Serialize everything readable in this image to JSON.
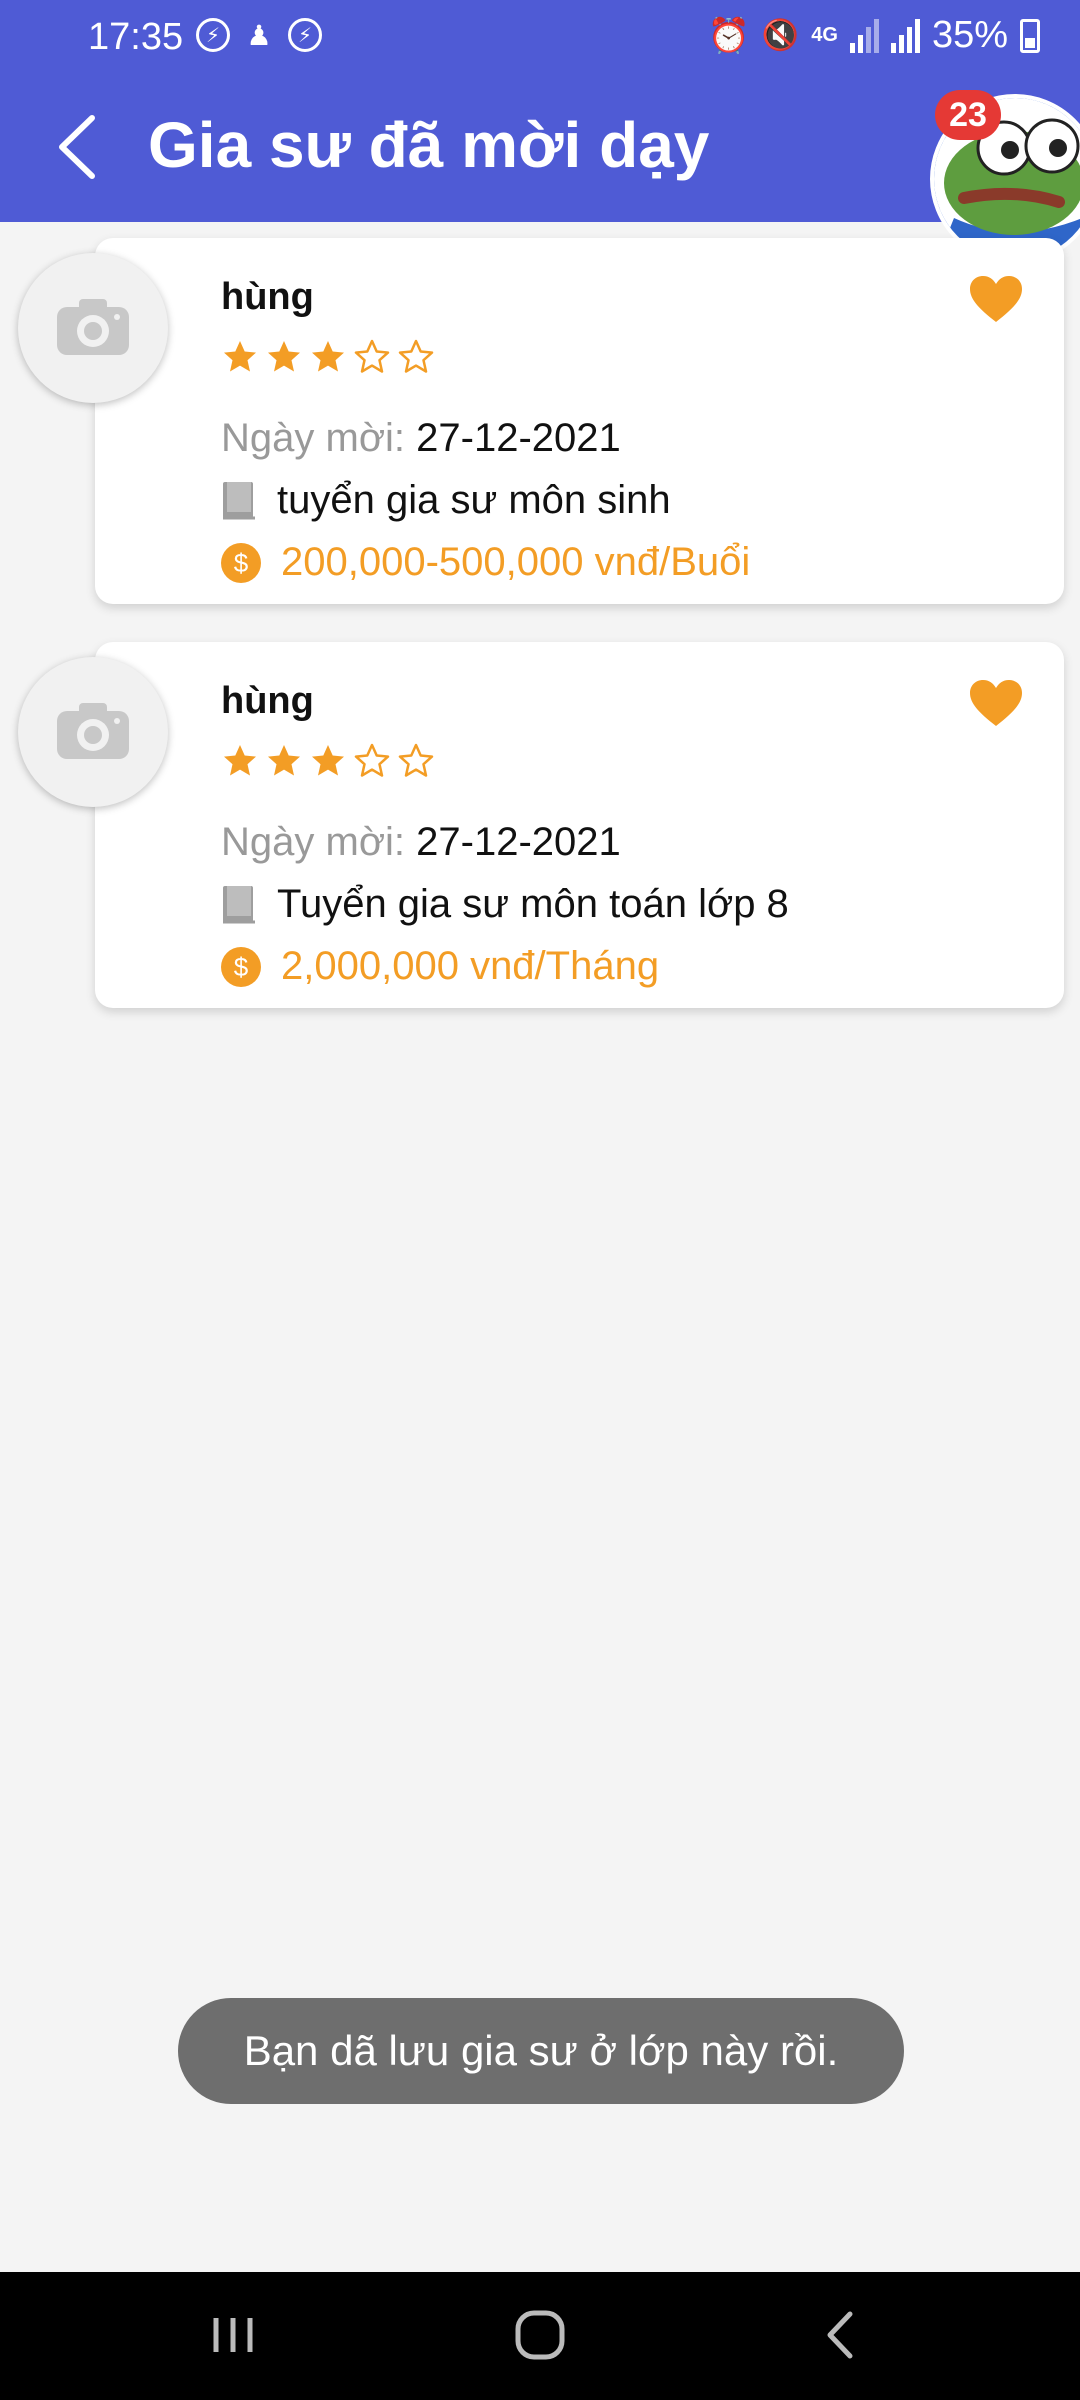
{
  "status_bar": {
    "time": "17:35",
    "network": "4G",
    "battery": "35%"
  },
  "header": {
    "title": "Gia sư đã mời dạy",
    "chat_head_badge": "23"
  },
  "tutors": [
    {
      "name": "hùng",
      "rating": 3,
      "rating_max": 5,
      "date_label": "Ngày mời:",
      "date": "27-12-2021",
      "subject": "tuyển gia sư môn sinh",
      "price": "200,000-500,000 vnđ/Buổi"
    },
    {
      "name": "hùng",
      "rating": 3,
      "rating_max": 5,
      "date_label": "Ngày mời:",
      "date": "27-12-2021",
      "subject": "Tuyển gia sư môn toán lớp 8",
      "price": "2,000,000 vnđ/Tháng"
    }
  ],
  "toast": "Bạn dã lưu gia sư ở lớp này rồi.",
  "colors": {
    "appbar": "#4f5bd5",
    "accent": "#f39d25",
    "badge": "#e53935"
  },
  "icons": [
    "back-arrow-icon",
    "camera-icon",
    "star-icon",
    "heart-icon",
    "book-icon",
    "dollar-coin-icon",
    "recent-apps-icon",
    "home-icon",
    "nav-back-icon"
  ]
}
